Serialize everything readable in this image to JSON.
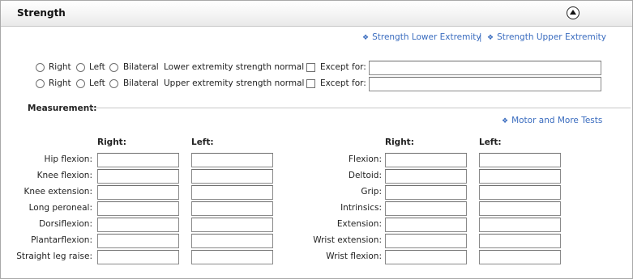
{
  "header": {
    "title": "Strength",
    "collapse_icon": "collapse-up-icon"
  },
  "links": {
    "lower": "Strength Lower Extremity",
    "separator": "|",
    "upper": "Strength Upper Extremity",
    "motor": "Motor and More Tests"
  },
  "side_row_lower": {
    "right": "Right",
    "left": "Left",
    "bilateral": "Bilateral",
    "normal_label": "Lower extremity strength normal",
    "except_label": "Except for:",
    "except_value": ""
  },
  "side_row_upper": {
    "right": "Right",
    "left": "Left",
    "bilateral": "Bilateral",
    "normal_label": "Upper extremity strength normal",
    "except_label": "Except for:",
    "except_value": ""
  },
  "measurement": {
    "title": "Measurement:",
    "lower": {
      "right_header": "Right:",
      "left_header": "Left:",
      "rows": [
        "Hip flexion:",
        "Knee flexion:",
        "Knee extension:",
        "Long peroneal:",
        "Dorsiflexion:",
        "Plantarflexion:",
        "Straight leg raise:"
      ]
    },
    "upper": {
      "right_header": "Right:",
      "left_header": "Left:",
      "rows": [
        "Flexion:",
        "Deltoid:",
        "Grip:",
        "Intrinsics:",
        "Extension:",
        "Wrist extension:",
        "Wrist flexion:"
      ]
    }
  },
  "colors": {
    "link": "#3a6cbf",
    "border": "#a9a9a9"
  }
}
